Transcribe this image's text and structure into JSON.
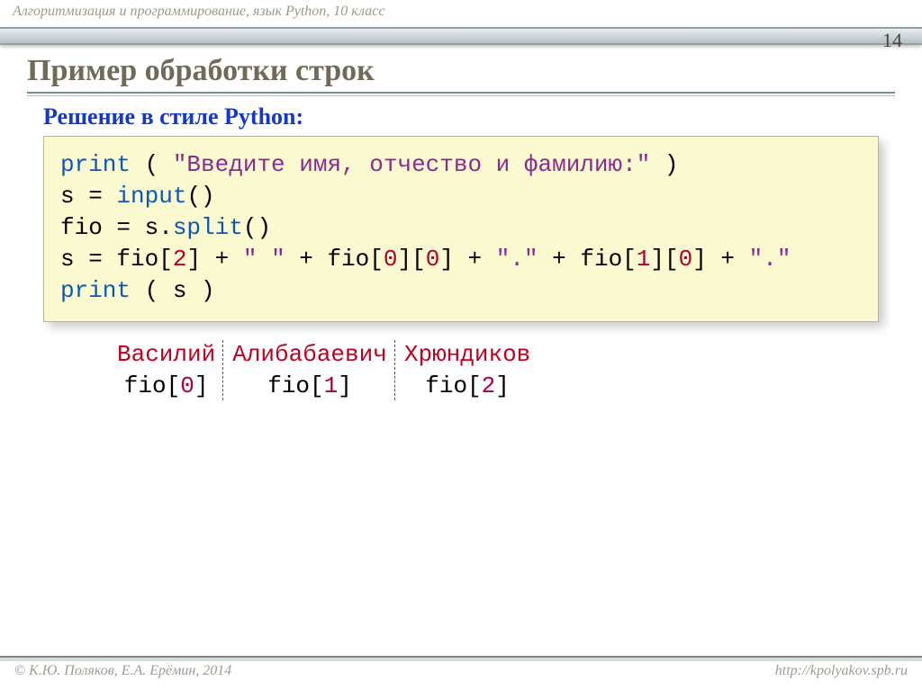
{
  "header": {
    "course": "Алгоритмизация и программирование, язык Python, 10 класс",
    "page": "14"
  },
  "title": "Пример обработки строк",
  "subtitle": "Решение в стиле Python:",
  "code": {
    "print1_kw": "print",
    "print1_open": " ( ",
    "print1_str": "\"Введите имя, отчество и фамилию:\"",
    "print1_close": " )",
    "l2_a": "s = ",
    "l2_input": "input",
    "l2_b": "()",
    "l3_a": "fio = s.",
    "l3_split": "split",
    "l3_b": "()",
    "l4_a": "s = fio[",
    "l4_n2": "2",
    "l4_b": "] + ",
    "l4_s1": "\" \"",
    "l4_c": " + fio[",
    "l4_n0a": "0",
    "l4_d": "][",
    "l4_n0b": "0",
    "l4_e": "] + ",
    "l4_s2": "\".\"",
    "l4_f": " + fio[",
    "l4_n1": "1",
    "l4_g": "][",
    "l4_n0c": "0",
    "l4_h": "] + ",
    "l4_s3": "\".\"",
    "print2_kw": "print",
    "print2_rest": " ( s )"
  },
  "example": {
    "names": [
      "Василий",
      "Алибабаевич",
      "Хрюндиков"
    ],
    "labels_a": [
      "fio[",
      "fio[",
      "fio["
    ],
    "labels_n": [
      "0",
      "1",
      "2"
    ],
    "labels_b": [
      "]",
      "]",
      "]"
    ]
  },
  "footer": {
    "left": "© К.Ю. Поляков, Е.А. Ерёмин, 2014",
    "right": "http://kpolyakov.spb.ru"
  }
}
